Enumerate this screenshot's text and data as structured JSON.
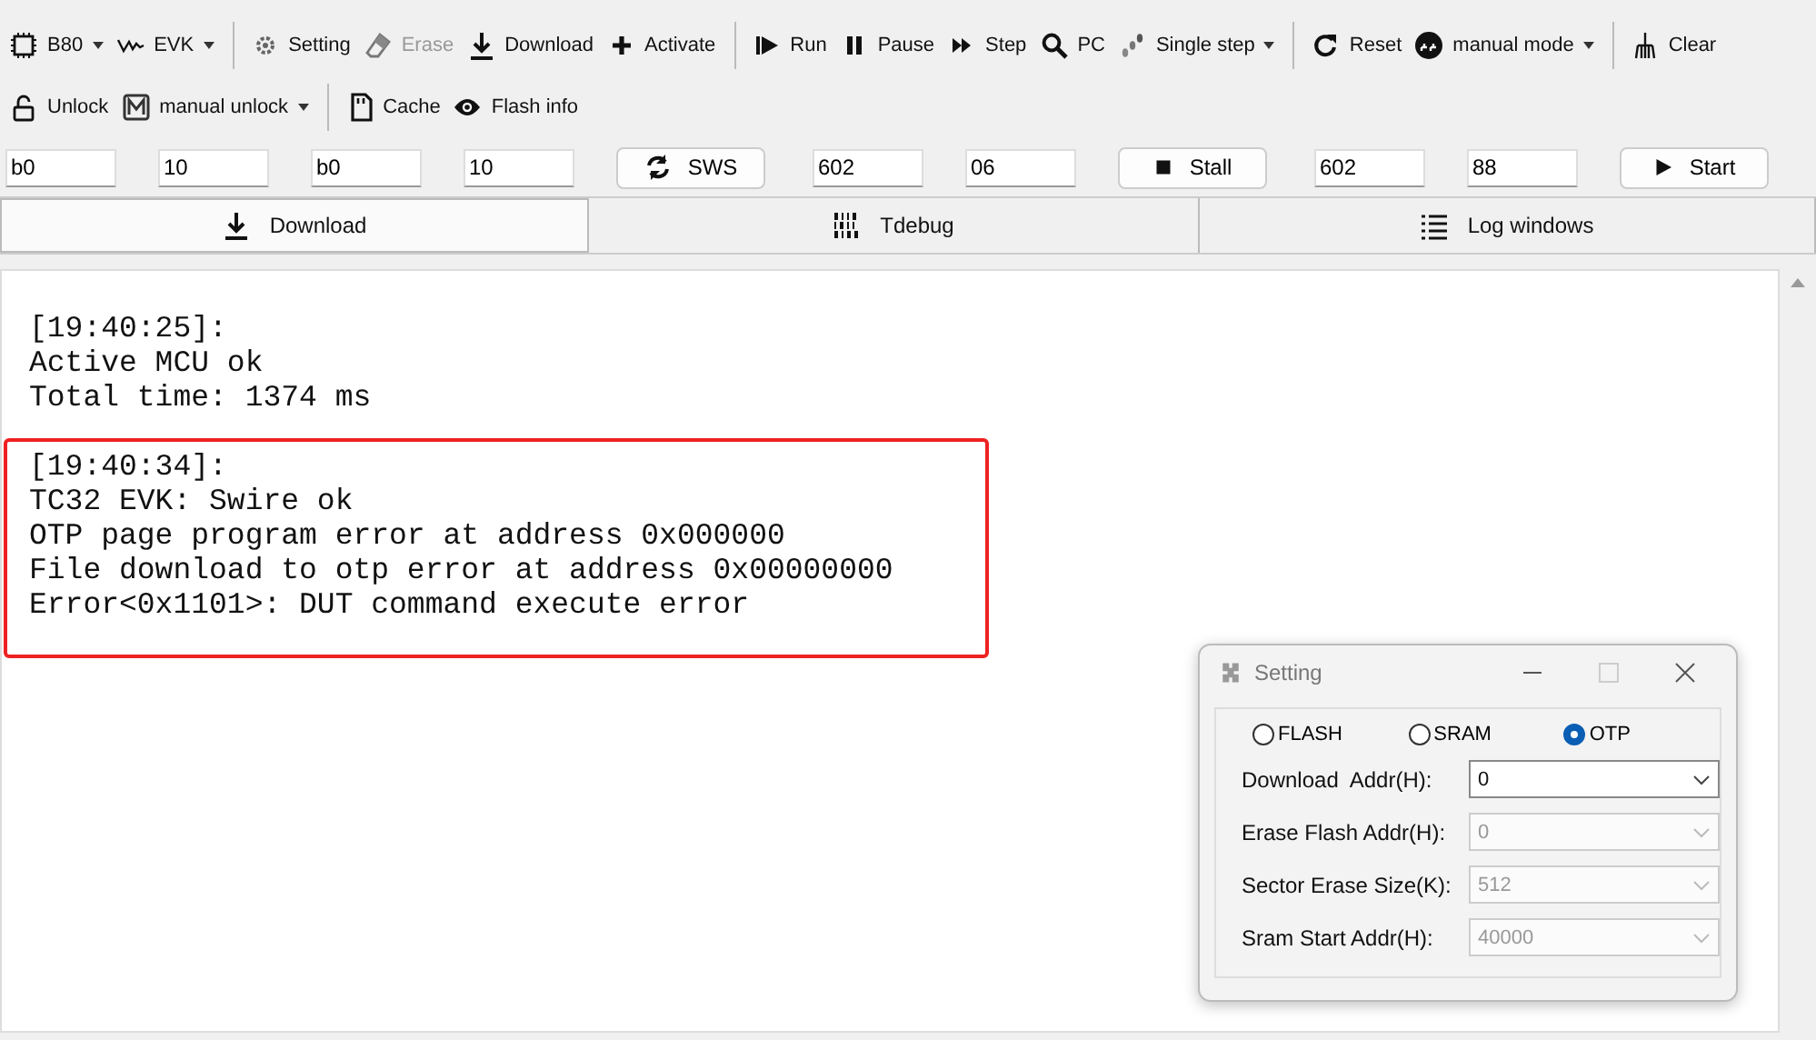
{
  "toolbar_rows": [
    {
      "groups": [
        [
          {
            "kind": "dropdown",
            "label": "B80",
            "disabled": false
          },
          {
            "kind": "dropdown",
            "label": "EVK",
            "disabled": false
          }
        ],
        [
          {
            "kind": "button",
            "label": "Setting",
            "disabled": false
          },
          {
            "kind": "button",
            "label": "Erase",
            "disabled": true
          },
          {
            "kind": "button",
            "label": "Download",
            "disabled": false
          },
          {
            "kind": "button",
            "label": "Activate",
            "disabled": false
          }
        ],
        [
          {
            "kind": "button",
            "label": "Run",
            "disabled": false
          },
          {
            "kind": "button",
            "label": "Pause",
            "disabled": false
          },
          {
            "kind": "button",
            "label": "Step",
            "disabled": false
          },
          {
            "kind": "button",
            "label": "PC",
            "disabled": false
          },
          {
            "kind": "dropdown",
            "label": "Single step",
            "disabled": false
          }
        ],
        [
          {
            "kind": "button",
            "label": "Reset",
            "disabled": false
          },
          {
            "kind": "dropdown",
            "label": "manual mode",
            "disabled": false
          }
        ],
        [
          {
            "kind": "button",
            "label": "Clear",
            "disabled": false
          }
        ]
      ]
    },
    {
      "groups": [
        [
          {
            "kind": "button",
            "label": "Unlock",
            "disabled": false
          },
          {
            "kind": "dropdown",
            "label": "manual unlock",
            "disabled": false
          }
        ],
        [
          {
            "kind": "button",
            "label": "Cache",
            "disabled": false
          },
          {
            "kind": "button",
            "label": "Flash info",
            "disabled": false
          }
        ]
      ]
    }
  ],
  "control_row": [
    {
      "kind": "field",
      "value": "b0"
    },
    {
      "kind": "field",
      "value": "10"
    },
    {
      "kind": "field",
      "value": "b0"
    },
    {
      "kind": "field",
      "value": "10"
    },
    {
      "kind": "button",
      "label": "SWS"
    },
    {
      "kind": "field",
      "value": "602"
    },
    {
      "kind": "field",
      "value": "06"
    },
    {
      "kind": "button",
      "label": "Stall"
    },
    {
      "kind": "field",
      "value": "602"
    },
    {
      "kind": "field",
      "value": "88"
    },
    {
      "kind": "button",
      "label": "Start"
    }
  ],
  "tabs": [
    {
      "label": "Download",
      "selected": true
    },
    {
      "label": "Tdebug",
      "selected": false
    },
    {
      "label": "Log windows",
      "selected": false
    }
  ],
  "log": [
    {
      "highlighted": false,
      "lines": [
        "[19:40:25]:",
        "Active MCU ok",
        "Total time: 1374 ms"
      ]
    },
    {
      "highlighted": true,
      "lines": [
        "[19:40:34]:",
        "TC32 EVK: Swire ok",
        "OTP page program error at address 0x000000",
        "File download to otp error at address 0x00000000",
        "Error<0x1101>: DUT command execute error"
      ]
    }
  ],
  "dialog": {
    "title": "Setting",
    "radios": [
      {
        "label": "FLASH",
        "selected": false
      },
      {
        "label": "SRAM",
        "selected": false
      },
      {
        "label": "OTP",
        "selected": true
      }
    ],
    "fields": [
      {
        "label": "Download  Addr(H):",
        "value": "0",
        "disabled": false
      },
      {
        "label": "Erase Flash Addr(H):",
        "value": "0",
        "disabled": true
      },
      {
        "label": "Sector Erase Size(K):",
        "value": "512",
        "disabled": true
      },
      {
        "label": "Sram Start Addr(H):",
        "value": "40000",
        "disabled": true
      }
    ]
  }
}
